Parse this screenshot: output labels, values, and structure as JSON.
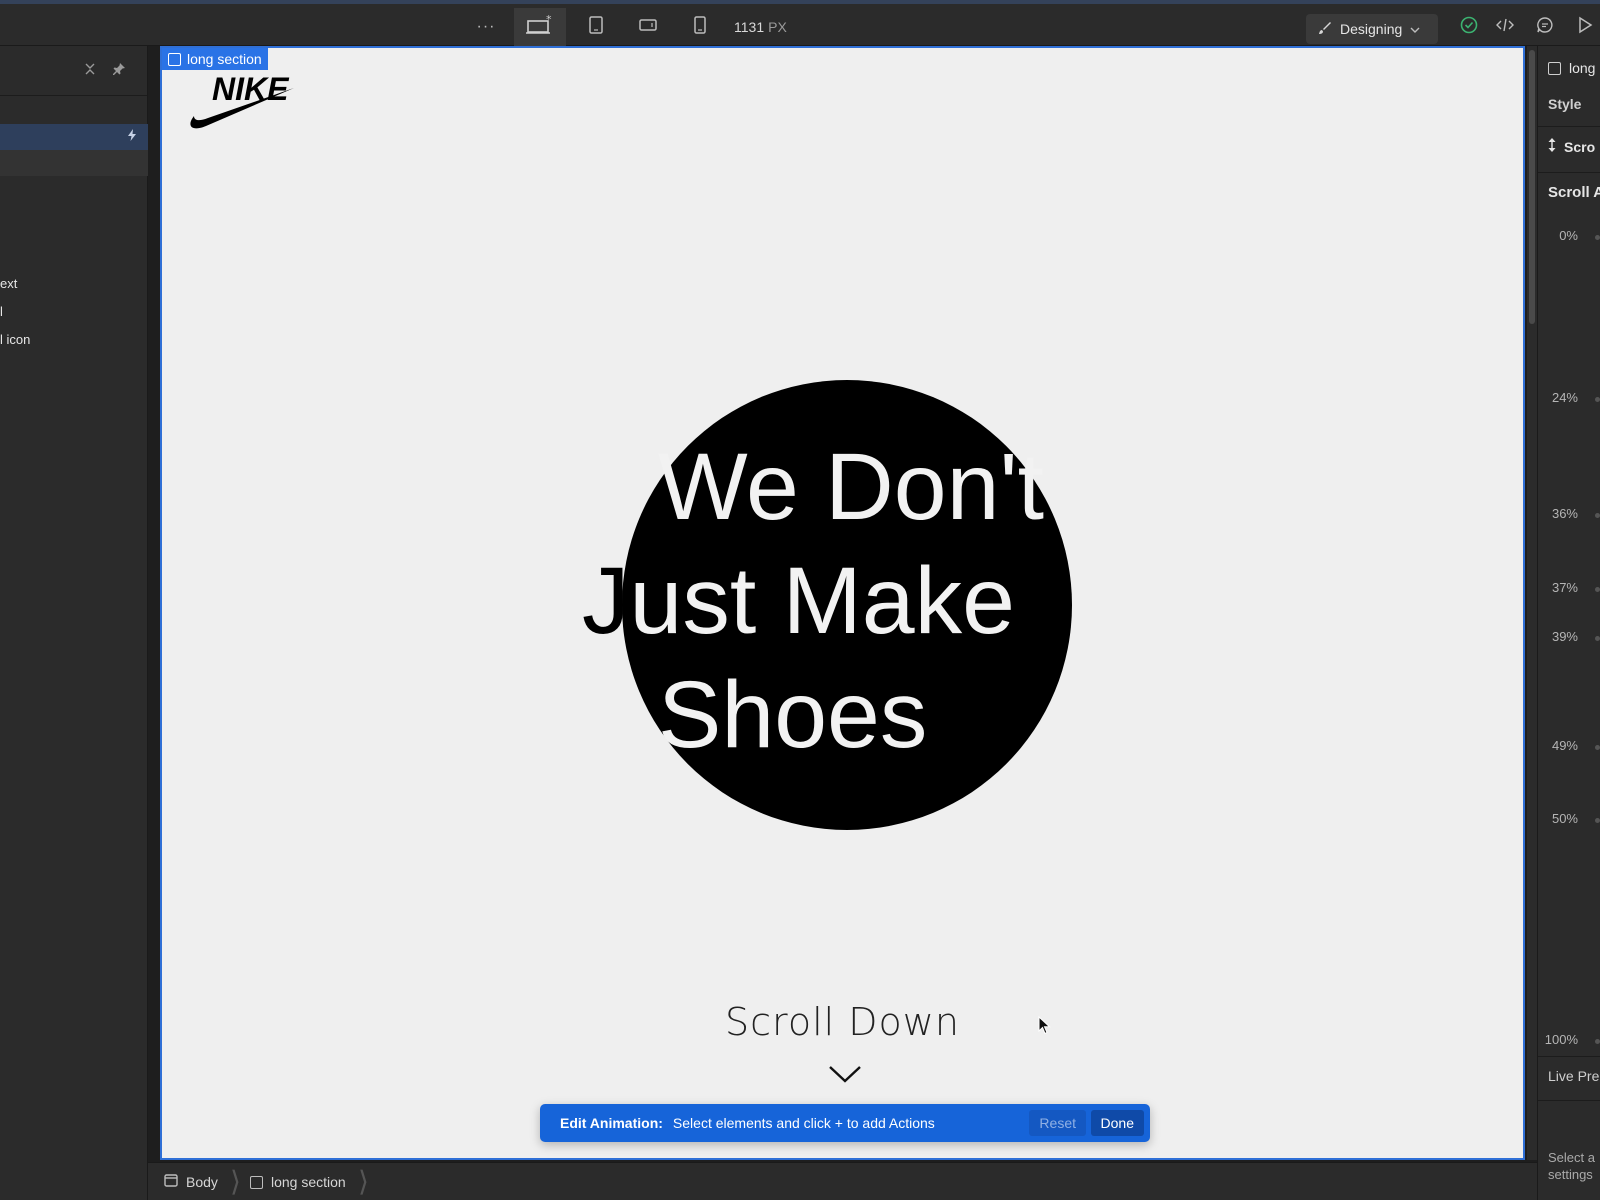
{
  "topbar": {
    "more_label": "···",
    "width_value": "1131",
    "width_unit": "PX",
    "mode_label": "Designing"
  },
  "left_panel": {
    "items": [
      {
        "label": "ext"
      },
      {
        "label": "l"
      },
      {
        "label": "l icon"
      }
    ]
  },
  "canvas": {
    "selected_tag": "long section",
    "logo_text": "NIKE",
    "headline": {
      "line1": "We Don't",
      "line2": "Just Make",
      "line3": "Shoes"
    },
    "scroll_label": "Scroll Down"
  },
  "animation_bar": {
    "title": "Edit Animation:",
    "message": "Select elements and click + to add Actions",
    "reset_label": "Reset",
    "done_label": "Done"
  },
  "right_panel": {
    "selected": "long",
    "style_tab": "Style",
    "scroll_row": "Scro",
    "section_title": "Scroll A",
    "keyframes": [
      "0%",
      "24%",
      "36%",
      "37%",
      "39%",
      "49%",
      "50%",
      "100%"
    ],
    "live_preview": "Live Pre",
    "select_hint_1": "Select a",
    "select_hint_2": "settings"
  },
  "breadcrumb": [
    {
      "label": "Body"
    },
    {
      "label": "long section"
    }
  ],
  "colors": {
    "accent": "#1664d9",
    "selection": "#2a73e6",
    "panel": "#2b2b2b",
    "canvas_bg": "#efefef"
  }
}
